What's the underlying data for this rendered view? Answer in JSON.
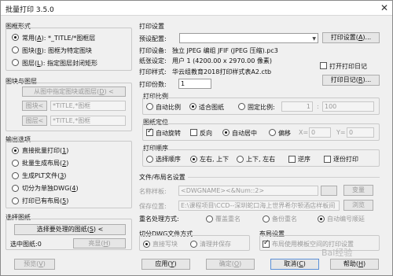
{
  "window": {
    "title": "批量打印 3.5.0",
    "close": "✕"
  },
  "left": {
    "frame_form": {
      "title": "图框形式",
      "opt_normal": "常用(<u>A</u>): *_TITLE/*图框层",
      "opt_block": "图块(<u>B</u>): 图框为特定图块",
      "opt_layer": "图层(<u>L</u>): 指定图层封闭矩形"
    },
    "block_layer": {
      "title": "图块与图层",
      "pick_btn": "从图中指定图块或图层(<u>D</u>) <",
      "block_btn": "图块<",
      "block_val": "*TITLE,*图框",
      "layer_btn": "图层<",
      "layer_val": "*TITLE,*图框"
    },
    "output": {
      "title": "输出选项",
      "opt1": "直接批量打印(<u>1</u>)",
      "opt2": "批量生成布局(<u>2</u>)",
      "opt3": "生成PLT文件(<u>3</u>)",
      "opt4": "切分为单独DWG(<u>4</u>)",
      "opt5": "打印已有布局(<u>5</u>)"
    },
    "select": {
      "title": "选择图纸",
      "select_btn": "选择要处理的图纸(<u>S</u>) <",
      "selected_label": "选中图纸:0",
      "highlight_btn": "亮显(<u>H</u>)",
      "preview_btn": "预览(<u>V</u>)"
    }
  },
  "right": {
    "print_settings": {
      "title": "打印设置",
      "preset_label": "预设配置:",
      "preset_value": "",
      "print_setup_btn": "打印设置(<u>A</u>)...",
      "device_label": "打印设备:",
      "device_value": "独立 JPEG 编组 JFIF (JPEG 压缩).pc3",
      "paper_label": "纸张设定:",
      "paper_value": "用户 1 (4200.00 x 2970.00 像素)",
      "style_label": "打印样式:",
      "style_value": "华云组教育2018打印样式表A2.ctb",
      "open_log_chk": "打开打印日记",
      "log_btn": "打印日记(<u>R</u>)...",
      "copies_label": "打印份数:",
      "copies_value": "1"
    },
    "scale": {
      "title": "打印比例",
      "auto": "自动比例",
      "fit": "适合图纸",
      "fixed": "固定比例:",
      "ratio_left": "1",
      "ratio_sep": ":",
      "ratio_right": "100"
    },
    "position": {
      "title": "图纸定位",
      "auto_rotate": "自动旋转",
      "reverse": "反向",
      "auto_center": "自动居中",
      "offset": "偏移",
      "x_label": "X=",
      "x_val": "0",
      "y_label": "Y=",
      "y_val": "0"
    },
    "order": {
      "title": "打印顺序",
      "select_order": "选择顺序",
      "lr_tb": "左右, 上下",
      "tb_lr": "上下, 左右",
      "reverse": "逆序",
      "page_by_page": "逐份打印"
    },
    "file_layout": {
      "title": "文件/布局名设置",
      "name_label": "名称样板:",
      "name_value": "<DWGNAME><&Num::2>",
      "var_btn": "变量",
      "save_label": "保存位置:",
      "save_value": "E:\\课程项目\\CCD--深圳蛇口海上世界希尔顿酒店样板间",
      "browse_btn": "浏览"
    },
    "rename": {
      "title": "重名处理方式:",
      "overwrite": "覆盖重名",
      "backup": "备份重名",
      "auto_number": "自动编号顺延"
    },
    "split_dwg": {
      "title": "切分DWG文件方式",
      "direct": "直接写块",
      "cleanup": "清理并保存"
    },
    "layout": {
      "title": "布局设置",
      "use_template": "布局使用模板空间的打印设置"
    }
  },
  "footer": {
    "apply_btn": "应用(<u>Y</u>)",
    "ok_btn": "确定(<u>O</u>)",
    "cancel_btn": "取消(<u>C</u>)",
    "help_btn": "帮助(<u>H</u>)"
  },
  "watermark": "Bai经验"
}
